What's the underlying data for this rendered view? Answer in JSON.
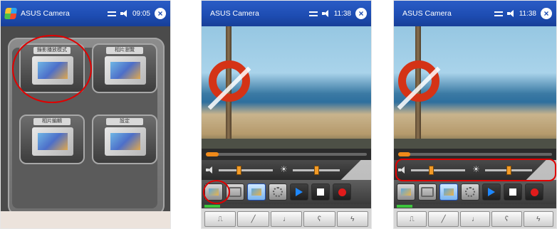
{
  "panels": [
    {
      "app_title": "ASUS Camera",
      "clock": "09:05",
      "menu_items": [
        {
          "label": "錄影播放模式",
          "icon": "video-playback-icon"
        },
        {
          "label": "相片瀏覽",
          "icon": "photo-browse-icon"
        },
        {
          "label": "相片編輯",
          "icon": "photo-edit-icon"
        },
        {
          "label": "設定",
          "icon": "settings-icon"
        }
      ]
    },
    {
      "app_title": "ASUS Camera",
      "clock": "11:38"
    },
    {
      "app_title": "ASUS Camera",
      "clock": "11:38"
    }
  ],
  "controls": {
    "volume_level": 0.33,
    "brightness_level": 0.45,
    "seek_progress": 0.08
  },
  "colors": {
    "titlebar": "#1d4cb1",
    "highlight": "#e00000",
    "seek_fill": "#f08a1a",
    "record": "#e11b1b"
  }
}
